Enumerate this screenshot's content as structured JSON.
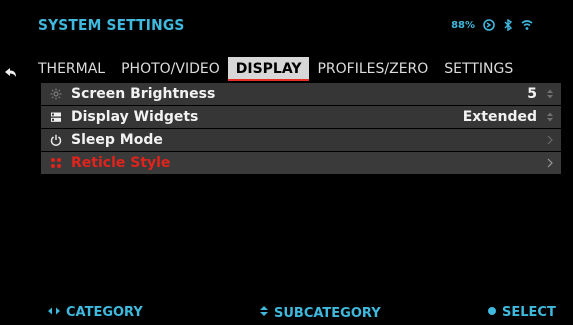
{
  "header": {
    "title": "SYSTEM SETTINGS",
    "battery": "88%",
    "icons": [
      "camera-icon",
      "bluetooth-icon",
      "wifi-icon"
    ]
  },
  "tabs": [
    {
      "label": "THERMAL",
      "active": false
    },
    {
      "label": "PHOTO/VIDEO",
      "active": false
    },
    {
      "label": "DISPLAY",
      "active": true
    },
    {
      "label": "PROFILES/ZERO",
      "active": false
    },
    {
      "label": "SETTINGS",
      "active": false
    }
  ],
  "rows": [
    {
      "icon": "brightness-icon",
      "label": "Screen Brightness",
      "value": "5",
      "control": "updown-icon"
    },
    {
      "icon": "widgets-icon",
      "label": "Display Widgets",
      "value": "Extended",
      "control": "updown-icon"
    },
    {
      "icon": "power-icon",
      "label": "Sleep Mode",
      "value": "",
      "control": "chevron-right-icon"
    },
    {
      "icon": "reticle-icon",
      "label": "Reticle Style",
      "value": "",
      "control": "chevron-right-icon",
      "selected": true
    }
  ],
  "footer": {
    "category": "CATEGORY",
    "subcategory": "SUBCATEGORY",
    "select": "SELECT"
  },
  "colors": {
    "accent": "#3fb9de",
    "highlight": "#e0231c",
    "row_bg": "#363636"
  }
}
